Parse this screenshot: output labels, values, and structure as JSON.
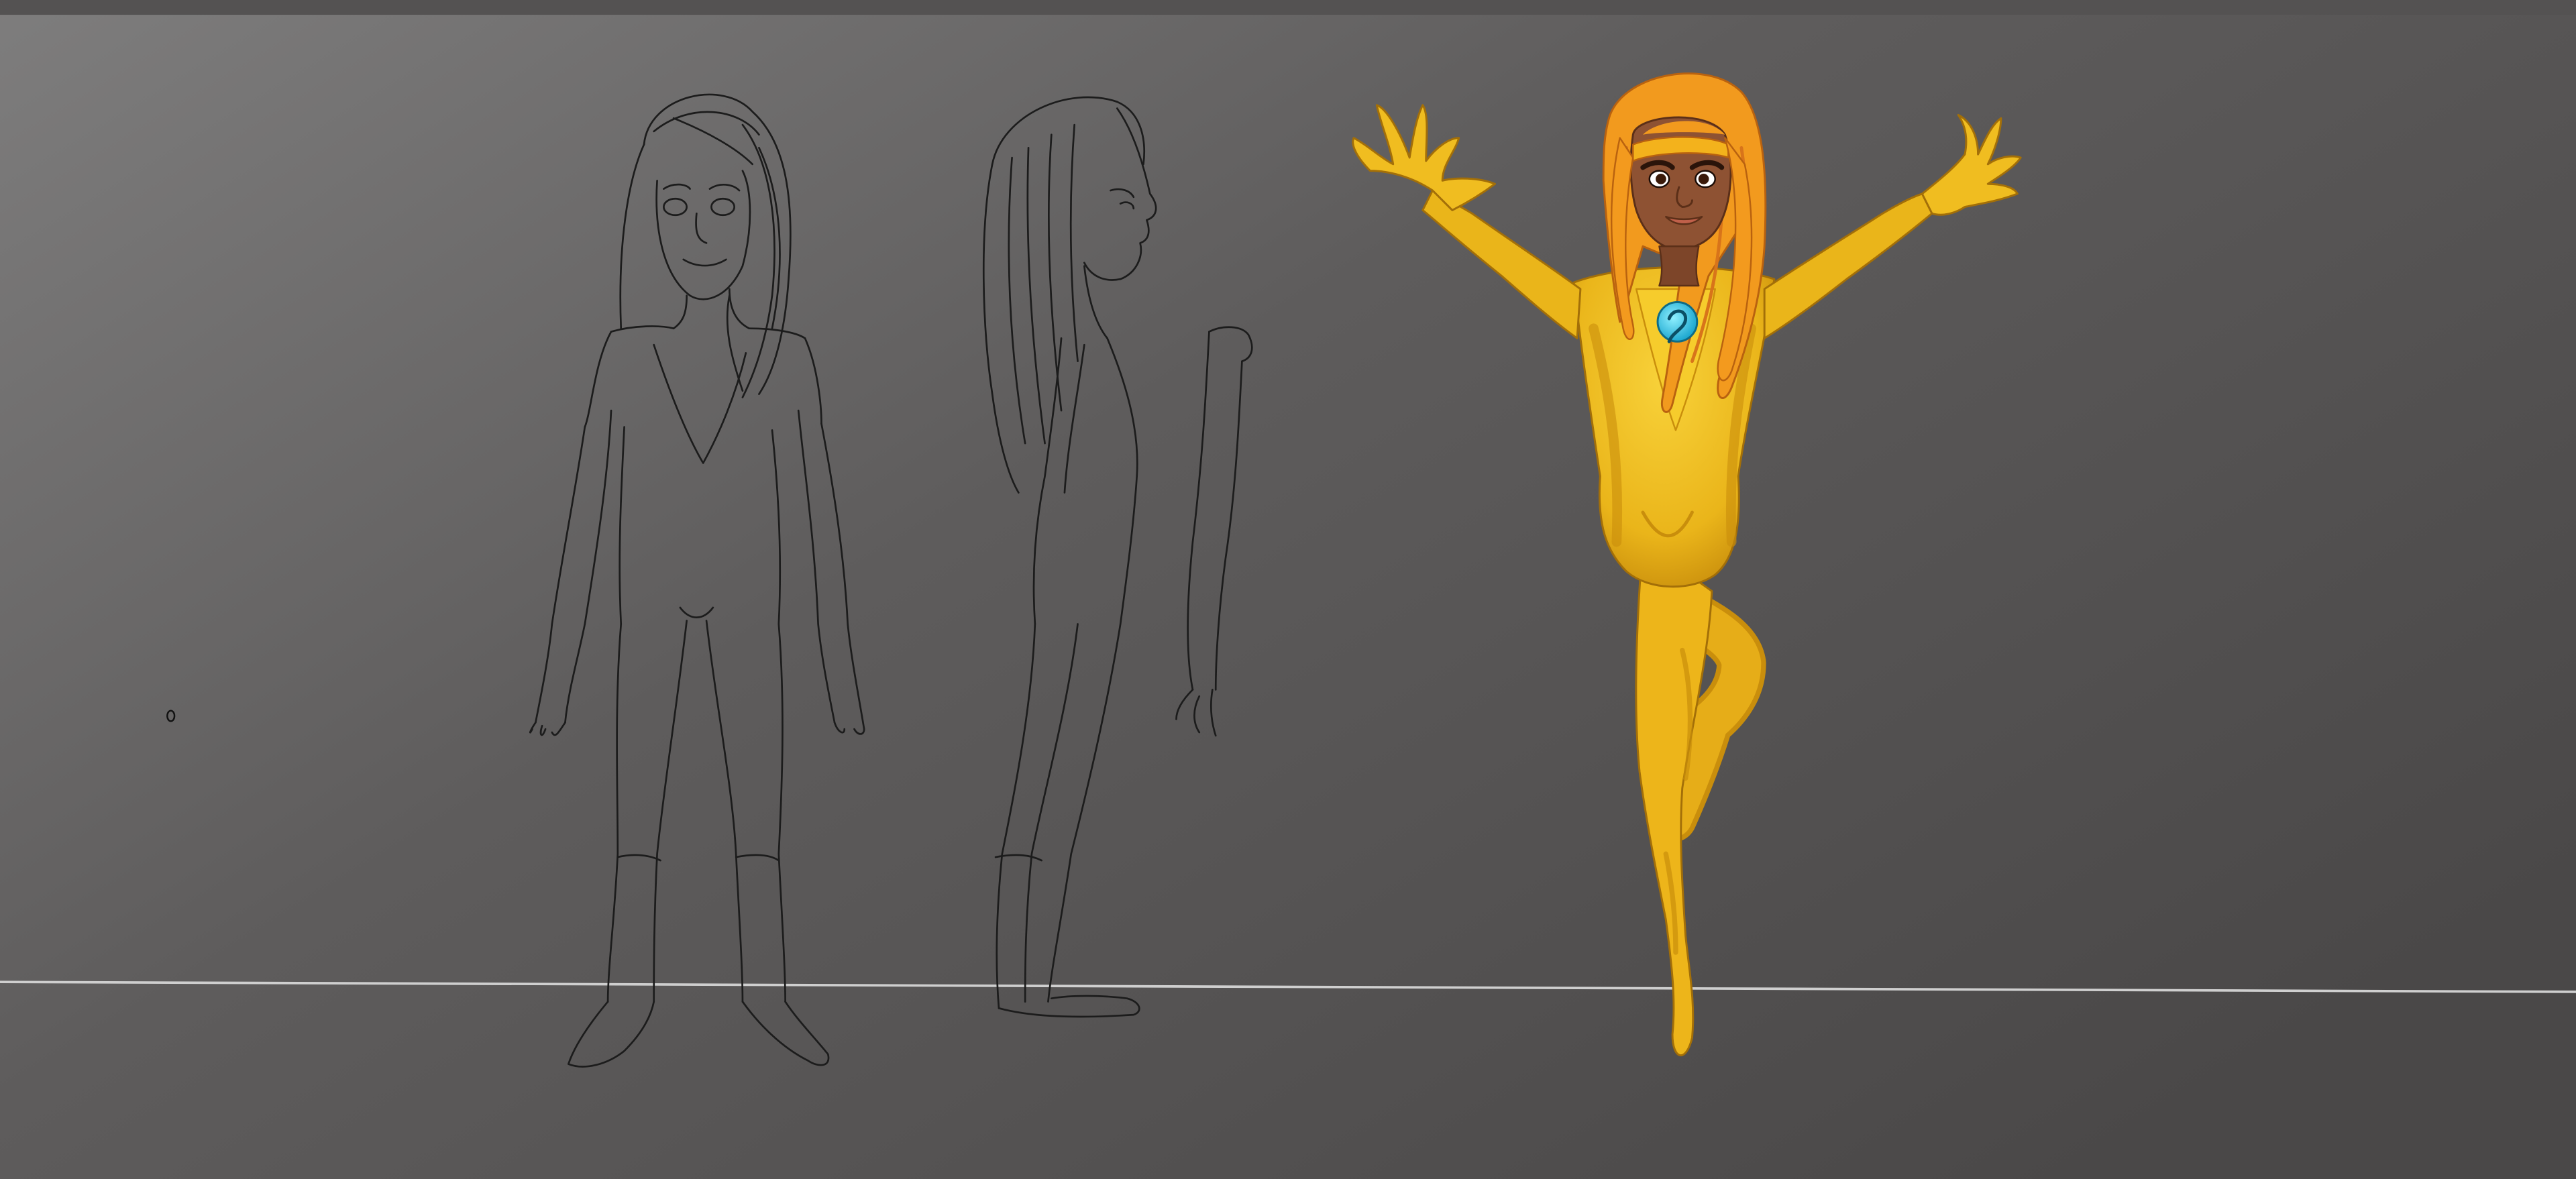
{
  "artwork": {
    "subject": "character-turnaround",
    "colors": {
      "background_light": "#7c7b7b",
      "background_dark": "#4b4949",
      "top_bar": "#545252",
      "horizon_line": "#c9c9c9",
      "sketch_line": "#1c1c1c",
      "suit_yellow": "#f1bf1c",
      "suit_shadow": "#c98e0c",
      "hair_orange": "#f39a1e",
      "hair_shadow": "#d8741a",
      "skin": "#8e5233",
      "skin_shadow": "#6e3b22",
      "emblem": "#2cc6e8"
    },
    "icons": [
      "brush-cursor-icon"
    ]
  }
}
